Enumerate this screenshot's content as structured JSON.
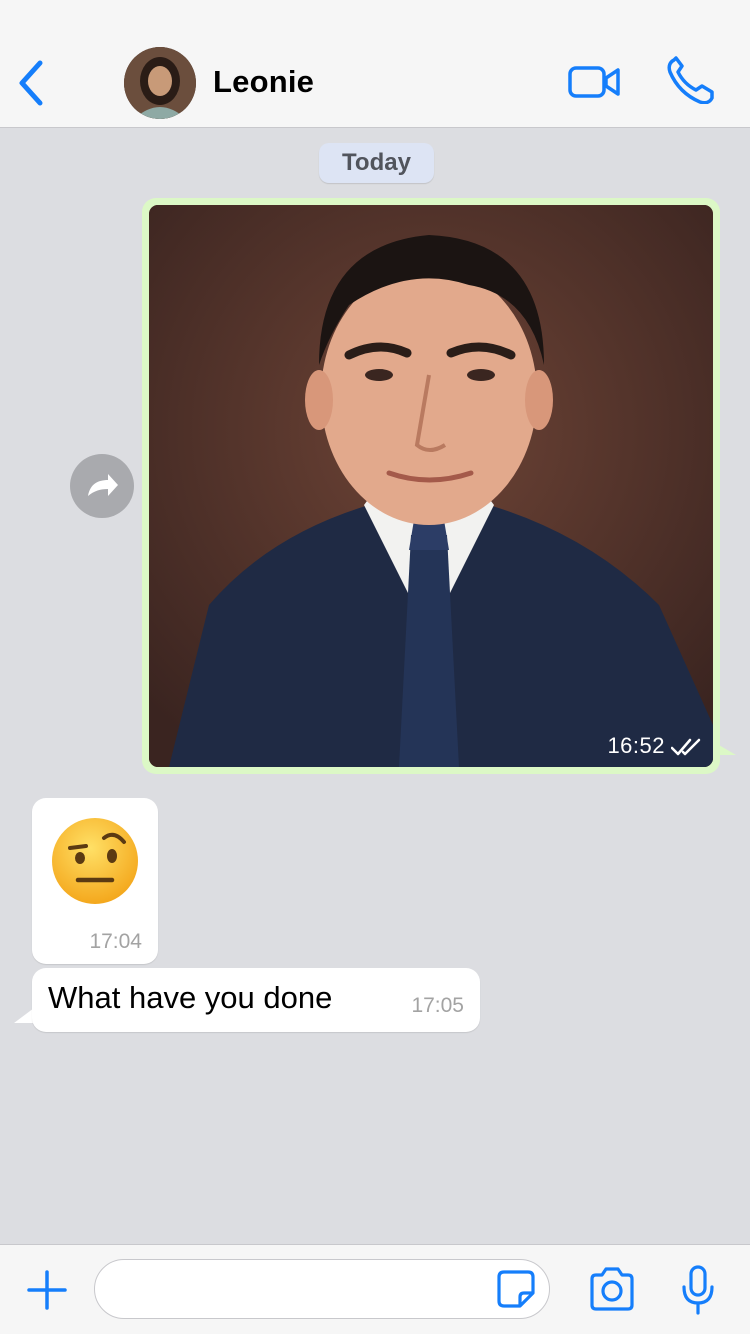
{
  "header": {
    "contact_name": "Leonie",
    "icons": {
      "back": "chevron-left-icon",
      "video": "video-camera-icon",
      "call": "phone-icon"
    },
    "accent_color": "#157efb"
  },
  "chat": {
    "date_separator": "Today",
    "messages": [
      {
        "type": "image",
        "direction": "outgoing",
        "time": "16:52",
        "status": "read",
        "status_icon": "double-check-icon"
      },
      {
        "type": "emoji",
        "direction": "incoming",
        "emoji": "face-with-raised-eyebrow",
        "time": "17:04"
      },
      {
        "type": "text",
        "direction": "incoming",
        "text": "What have you done",
        "time": "17:05"
      }
    ],
    "forward_icon": "forward-arrow-icon",
    "colors": {
      "outgoing_bubble": "#dcf8c6",
      "incoming_bubble": "#ffffff",
      "background": "#dcdde1"
    }
  },
  "input_bar": {
    "input_value": "",
    "icons": {
      "attach": "plus-icon",
      "sticker": "sticker-icon",
      "camera": "camera-icon",
      "mic": "microphone-icon"
    }
  }
}
